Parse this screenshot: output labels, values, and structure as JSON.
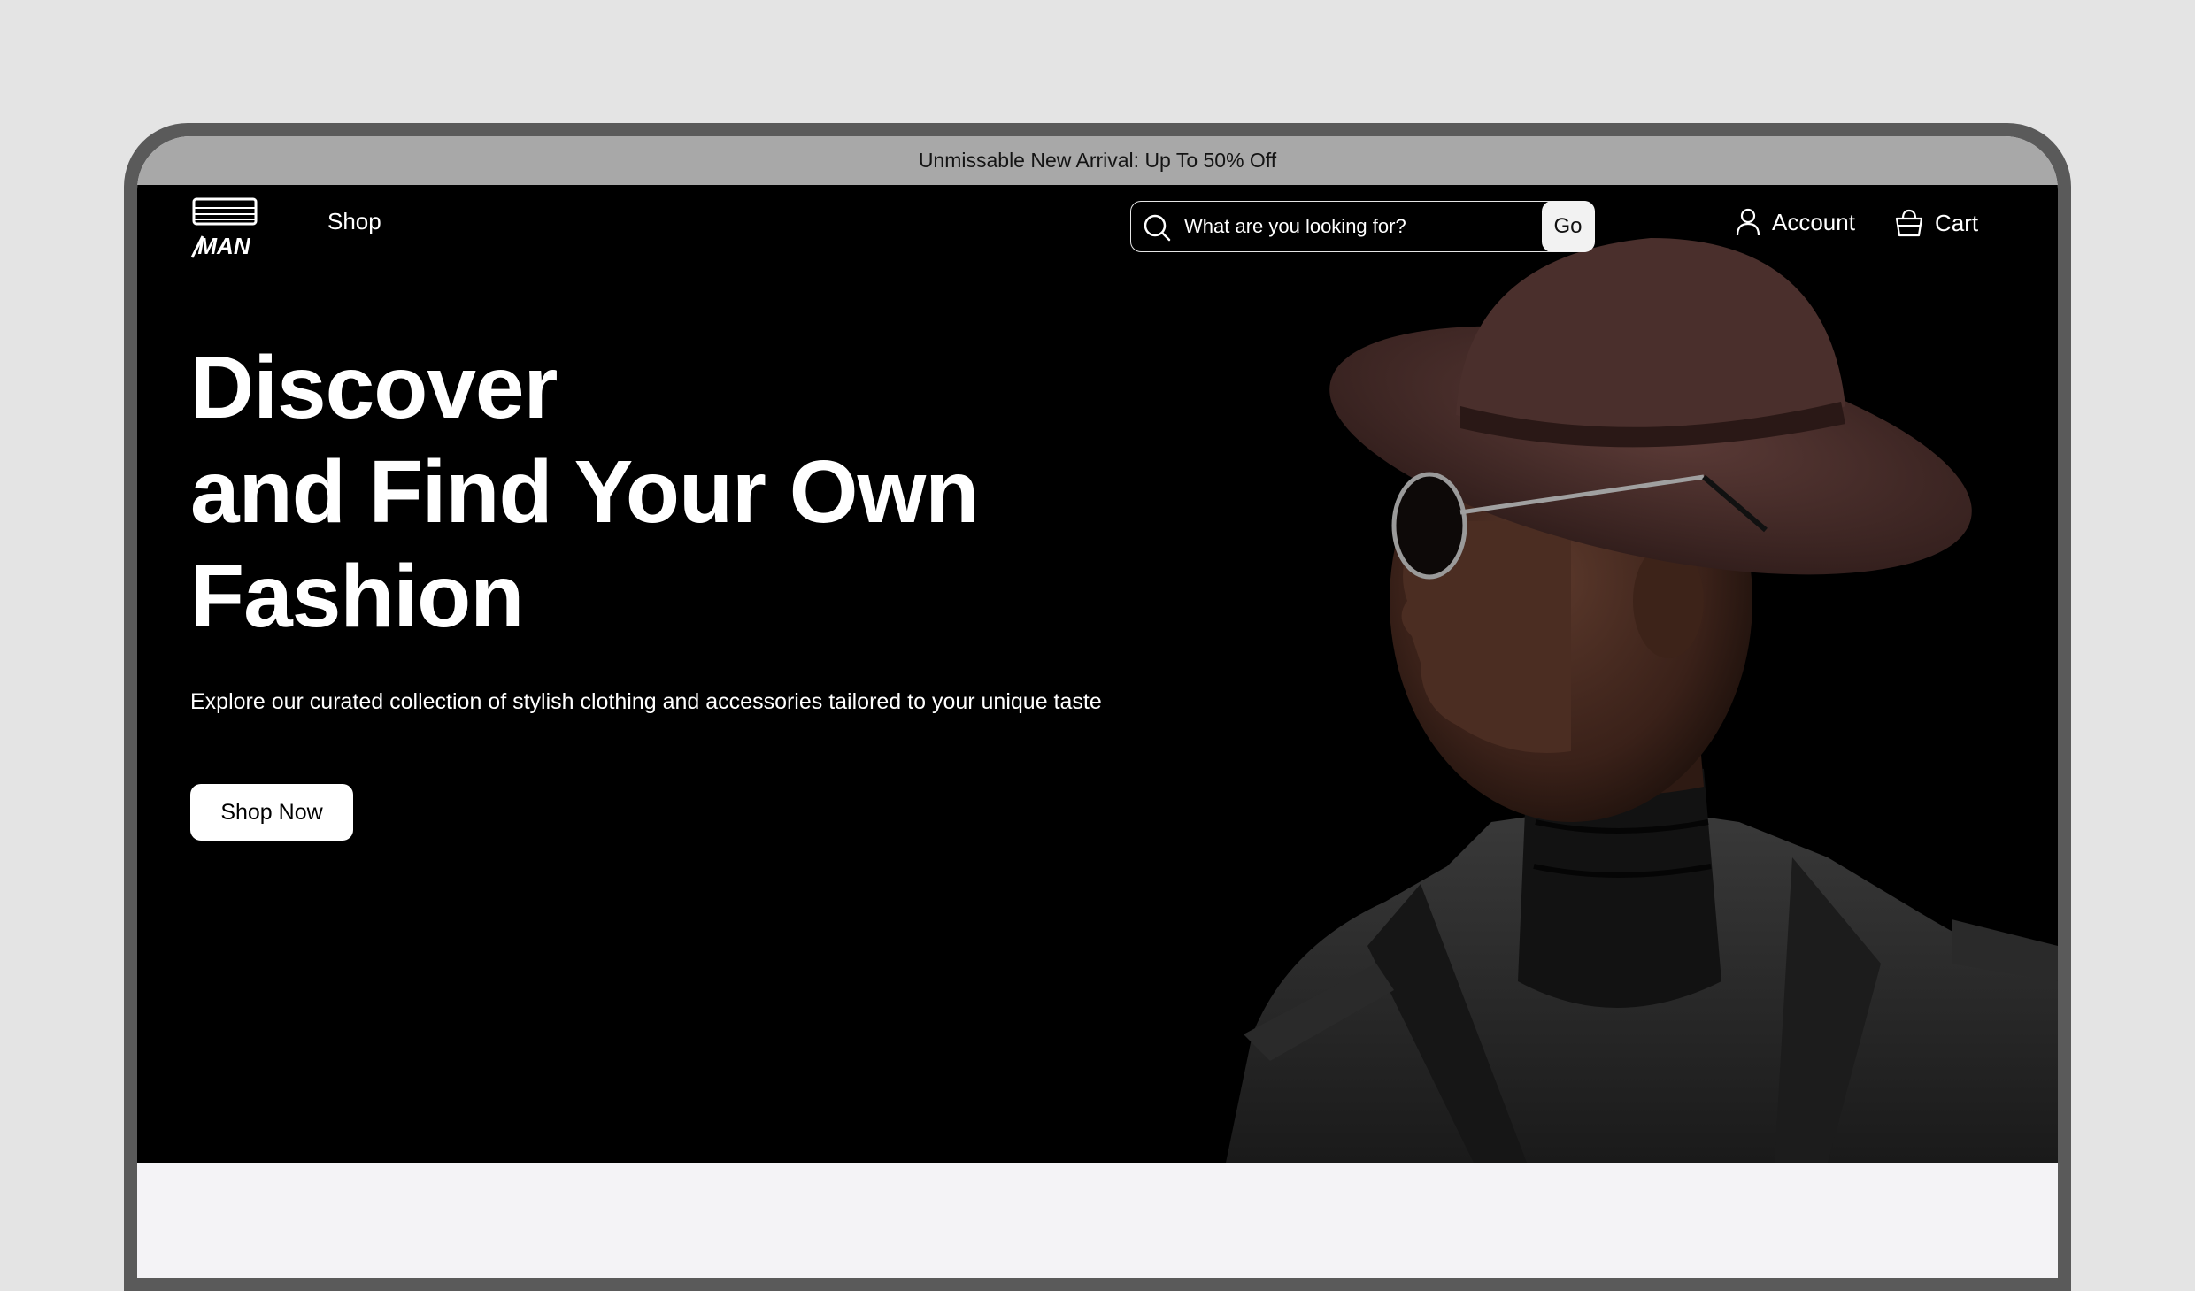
{
  "promo": {
    "text": "Unmissable New Arrival: Up  To 50% Off"
  },
  "header": {
    "logo_text": "MAN",
    "nav_shop": "Shop",
    "search": {
      "placeholder": "What are you looking for?",
      "value": "",
      "go_label": "Go"
    },
    "account_label": "Account",
    "cart_label": "Cart"
  },
  "hero": {
    "headline_line1": "Discover",
    "headline_line2": "and Find Your Own",
    "headline_line3": "Fashion",
    "subtitle": "Explore our curated collection of stylish clothing and accessories tailored to your unique taste",
    "cta_label": "Shop Now"
  },
  "colors": {
    "page_bg": "#e4e4e4",
    "device_frame": "#5a5a5a",
    "promo_bg": "#a8a8a8",
    "hero_bg": "#000000",
    "hat": "#4a2f2c",
    "coat": "#2b2b2b",
    "content_bg": "#f4f3f6"
  },
  "icons": {
    "search": "search-icon",
    "account": "user-icon",
    "cart": "basket-icon",
    "logo": "man-logo"
  }
}
